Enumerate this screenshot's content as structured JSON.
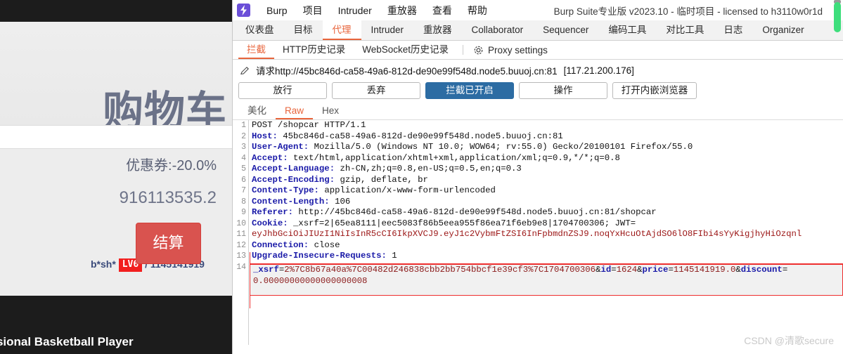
{
  "background_page": {
    "title": "购物车",
    "username": "b*sh*",
    "level_badge": "LV6",
    "separator": "/",
    "balance_top": "1145141919",
    "coupon": "优惠券:-20.0%",
    "total": "916113535.2",
    "checkout_button": "结算",
    "footer_text": "ofessional Basketball Player"
  },
  "burp": {
    "window_title": "Burp Suite专业版  v2023.10 - 临时项目 - licensed to h3110w0r1d",
    "menu": [
      "Burp",
      "项目",
      "Intruder",
      "重放器",
      "查看",
      "帮助"
    ],
    "main_tabs": [
      {
        "label": "仪表盘",
        "active": false
      },
      {
        "label": "目标",
        "active": false
      },
      {
        "label": "代理",
        "active": true
      },
      {
        "label": "Intruder",
        "active": false
      },
      {
        "label": "重放器",
        "active": false
      },
      {
        "label": "Collaborator",
        "active": false
      },
      {
        "label": "Sequencer",
        "active": false
      },
      {
        "label": "编码工具",
        "active": false
      },
      {
        "label": "对比工具",
        "active": false
      },
      {
        "label": "日志",
        "active": false
      },
      {
        "label": "Organizer",
        "active": false
      }
    ],
    "sub_tabs": [
      {
        "label": "拦截",
        "active": true
      },
      {
        "label": "HTTP历史记录",
        "active": false
      },
      {
        "label": "WebSocket历史记录",
        "active": false
      }
    ],
    "proxy_settings_label": "Proxy settings",
    "request_bar": {
      "url": "请求http://45bc846d-ca58-49a6-812d-de90e99f548d.node5.buuoj.cn:81",
      "ip": "[117.21.200.176]"
    },
    "action_buttons": [
      {
        "label": "放行",
        "primary": false
      },
      {
        "label": "丢弃",
        "primary": false
      },
      {
        "label": "拦截已开启",
        "primary": true
      },
      {
        "label": "操作",
        "primary": false
      },
      {
        "label": "打开内嵌浏览器",
        "primary": false
      }
    ],
    "view_tabs": [
      {
        "label": "美化",
        "active": false
      },
      {
        "label": "Raw",
        "active": true
      },
      {
        "label": "Hex",
        "active": false
      }
    ],
    "request": {
      "line_numbers": [
        "1",
        "2",
        "3",
        "4",
        "5",
        "6",
        "7",
        "8",
        "9",
        "10",
        "",
        "11",
        "12",
        "13",
        "14",
        ""
      ],
      "lines": [
        {
          "num": 1,
          "header": "",
          "text": "POST /shopcar HTTP/1.1"
        },
        {
          "num": 2,
          "header": "Host",
          "text": " 45bc846d-ca58-49a6-812d-de90e99f548d.node5.buuoj.cn:81"
        },
        {
          "num": 3,
          "header": "User-Agent",
          "text": " Mozilla/5.0 (Windows NT 10.0; WOW64; rv:55.0) Gecko/20100101 Firefox/55.0"
        },
        {
          "num": 4,
          "header": "Accept",
          "text": " text/html,application/xhtml+xml,application/xml;q=0.9,*/*;q=0.8"
        },
        {
          "num": 5,
          "header": "Accept-Language",
          "text": " zh-CN,zh;q=0.8,en-US;q=0.5,en;q=0.3"
        },
        {
          "num": 6,
          "header": "Accept-Encoding",
          "text": " gzip, deflate, br"
        },
        {
          "num": 7,
          "header": "Content-Type",
          "text": " application/x-www-form-urlencoded"
        },
        {
          "num": 8,
          "header": "Content-Length",
          "text": " 106"
        },
        {
          "num": 9,
          "header": "Referer",
          "text": " http://45bc846d-ca58-49a6-812d-de90e99f548d.node5.buuoj.cn:81/shopcar"
        },
        {
          "num": 10,
          "header": "Cookie",
          "text": " _xsrf=2|65ea8111|eec5083f86b5eea955f86ea71f6eb9e8|1704700306; JWT="
        },
        {
          "num": null,
          "header": "",
          "text": "eyJhbGciOiJIUzI1NiIsInR5cCI6IkpXVCJ9.eyJ1c2VybmFtZSI6InFpbmdnZSJ9.noqYxHcuOtAjdSO6lO8FIbi4sYyKigjhyHiOzqnl"
        },
        {
          "num": 11,
          "header": "Connection",
          "text": " close"
        },
        {
          "num": 12,
          "header": "Upgrade-Insecure-Requests",
          "text": " 1"
        },
        {
          "num": 13,
          "header": "",
          "text": ""
        }
      ],
      "body_line_number": 14,
      "body": "_xsrf=2%7C8b67a40a%7C00482d246838cbb2bb754bbcf1e39cf3%7C1704700306&id=1624&price=1145141919.0&discount=\n0.00000000000000000008"
    }
  },
  "watermark": "CSDN @清歌secure",
  "colors": {
    "accent_orange": "#e8653c",
    "primary_blue": "#2c6ca3",
    "header_blue": "#1a1aa8",
    "value_red": "#9b1515",
    "selection_red": "#ee2e2e",
    "checkout_red": "#d9534f",
    "badge_red": "#f21f1f",
    "green_scroll": "#3ede7c"
  }
}
